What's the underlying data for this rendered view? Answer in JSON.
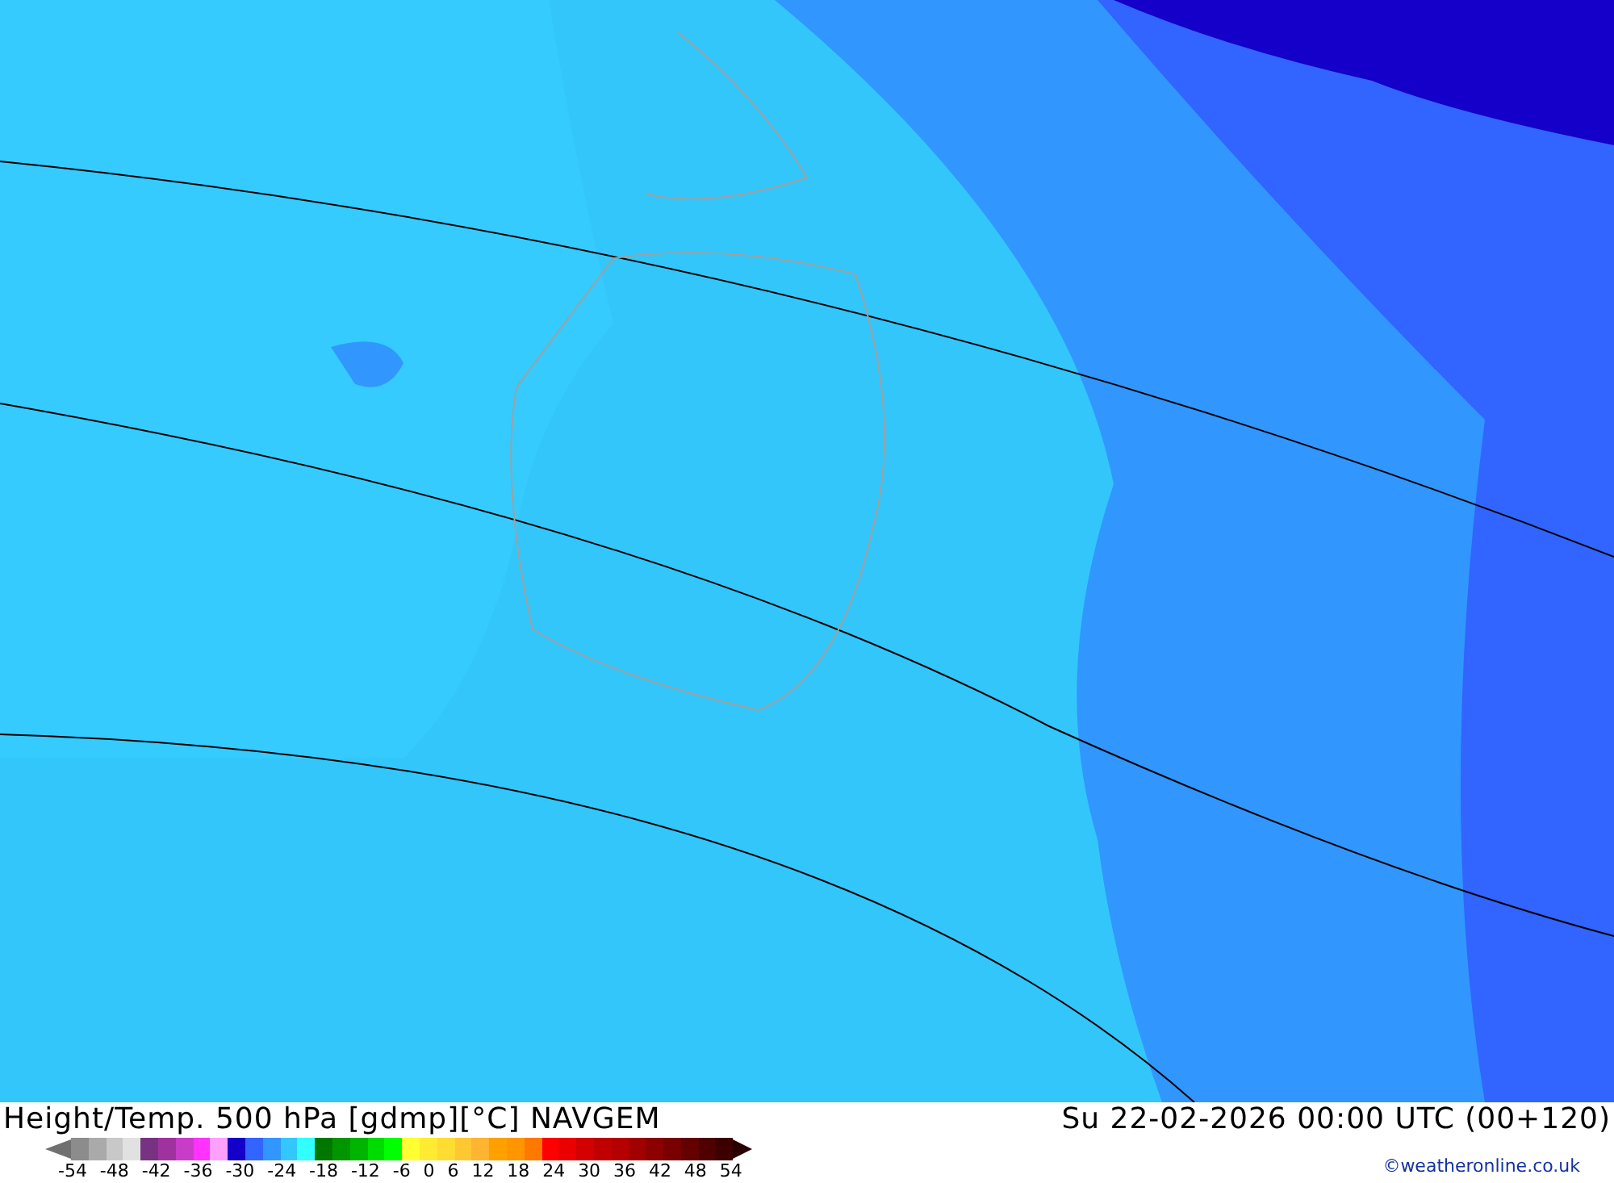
{
  "footer": {
    "title": "Height/Temp. 500 hPa [gdmp][°C] NAVGEM",
    "valid_time": "Su 22-02-2026 00:00 UTC (00+120)",
    "credit": "©weatheronline.co.uk"
  },
  "legend": {
    "swatches": [
      {
        "color": "#8c8c8c"
      },
      {
        "color": "#aaaaaa"
      },
      {
        "color": "#c8c8c8"
      },
      {
        "color": "#e1e1e1"
      },
      {
        "color": "#783282"
      },
      {
        "color": "#a032a0"
      },
      {
        "color": "#c83cc8"
      },
      {
        "color": "#ff32ff"
      },
      {
        "color": "#ffa0ff"
      },
      {
        "color": "#1400c8"
      },
      {
        "color": "#3264ff"
      },
      {
        "color": "#3296ff"
      },
      {
        "color": "#32c8ff"
      },
      {
        "color": "#32ffff"
      },
      {
        "color": "#007800"
      },
      {
        "color": "#009600"
      },
      {
        "color": "#00b400"
      },
      {
        "color": "#00dc00"
      },
      {
        "color": "#00ff00"
      },
      {
        "color": "#ffff32"
      },
      {
        "color": "#ffeb32"
      },
      {
        "color": "#ffdc32"
      },
      {
        "color": "#ffc832"
      },
      {
        "color": "#ffb432"
      },
      {
        "color": "#ffa000"
      },
      {
        "color": "#ff9600"
      },
      {
        "color": "#ff7800"
      },
      {
        "color": "#ff0000"
      },
      {
        "color": "#eb0000"
      },
      {
        "color": "#d20000"
      },
      {
        "color": "#c00000"
      },
      {
        "color": "#b40000"
      },
      {
        "color": "#a00000"
      },
      {
        "color": "#8c0000"
      },
      {
        "color": "#780000"
      },
      {
        "color": "#640000"
      },
      {
        "color": "#500000"
      },
      {
        "color": "#3c0000"
      }
    ],
    "labels": [
      "-54",
      "-48",
      "-42",
      "-36",
      "-30",
      "-24",
      "-18",
      "-12",
      "-6",
      "0",
      "6",
      "12",
      "18",
      "24",
      "30",
      "36",
      "42",
      "48",
      "54"
    ]
  }
}
